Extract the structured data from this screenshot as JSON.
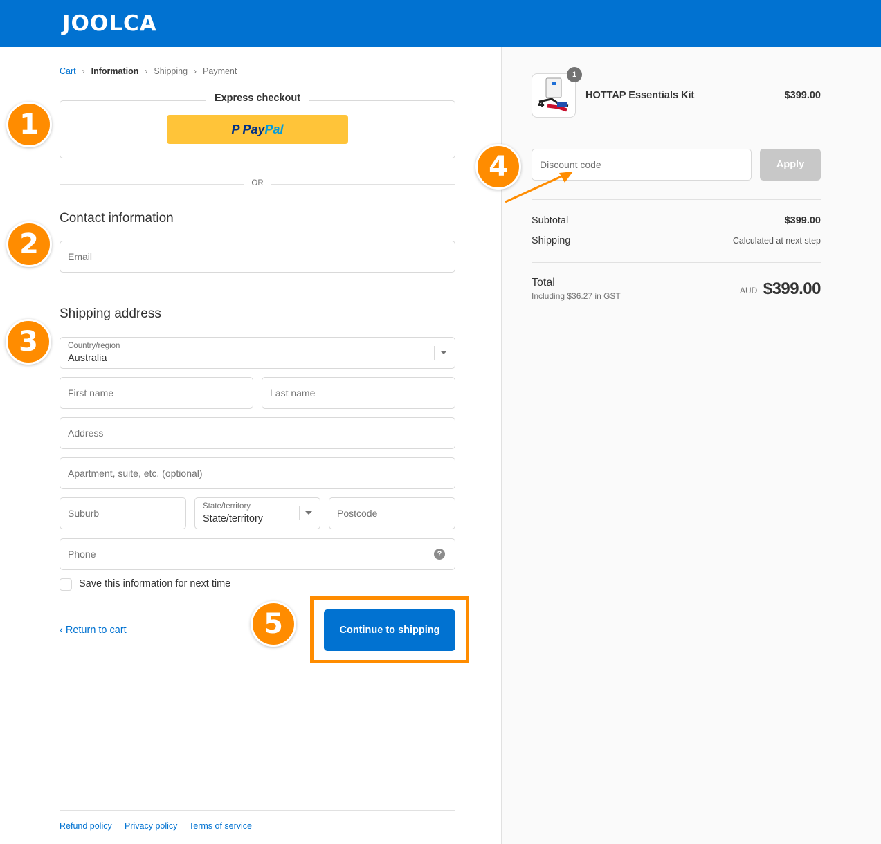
{
  "header": {
    "logo_text": "JOOLCA"
  },
  "breadcrumb": {
    "items": [
      "Cart",
      "Information",
      "Shipping",
      "Payment"
    ]
  },
  "express": {
    "title": "Express checkout",
    "paypal_a": "Pay",
    "paypal_b": "Pal",
    "paypal_mark": "P"
  },
  "divider": {
    "or_text": "OR"
  },
  "contact": {
    "title": "Contact information",
    "email_placeholder": "Email"
  },
  "shipping_address": {
    "title": "Shipping address",
    "country_label": "Country/region",
    "country_value": "Australia",
    "first_name_placeholder": "First name",
    "last_name_placeholder": "Last name",
    "address_placeholder": "Address",
    "apartment_placeholder": "Apartment, suite, etc. (optional)",
    "suburb_placeholder": "Suburb",
    "state_label": "State/territory",
    "state_value": "State/territory",
    "postcode_placeholder": "Postcode",
    "phone_placeholder": "Phone",
    "help_glyph": "?",
    "save_info_label": "Save this information for next time"
  },
  "actions": {
    "return_label": "‹ Return to cart",
    "continue_label": "Continue to shipping"
  },
  "footer": {
    "links": [
      "Refund policy",
      "Privacy policy",
      "Terms of service"
    ]
  },
  "annotations": {
    "badges": [
      "1",
      "2",
      "3",
      "4",
      "5"
    ],
    "accent_color": "#ff8c00"
  },
  "order_summary": {
    "product_name": "HOTTAP Essentials Kit",
    "product_price": "$399.00",
    "quantity": "1",
    "discount_placeholder": "Discount code",
    "apply_label": "Apply",
    "subtotal_label": "Subtotal",
    "subtotal_value": "$399.00",
    "shipping_label": "Shipping",
    "shipping_value": "Calculated at next step",
    "total_label": "Total",
    "total_note": "Including $36.27 in GST",
    "total_currency": "AUD",
    "total_value": "$399.00"
  },
  "colors": {
    "brand_blue": "#0172d1",
    "paypal_yellow": "#ffc439",
    "apply_disabled": "#c8c8c8"
  }
}
